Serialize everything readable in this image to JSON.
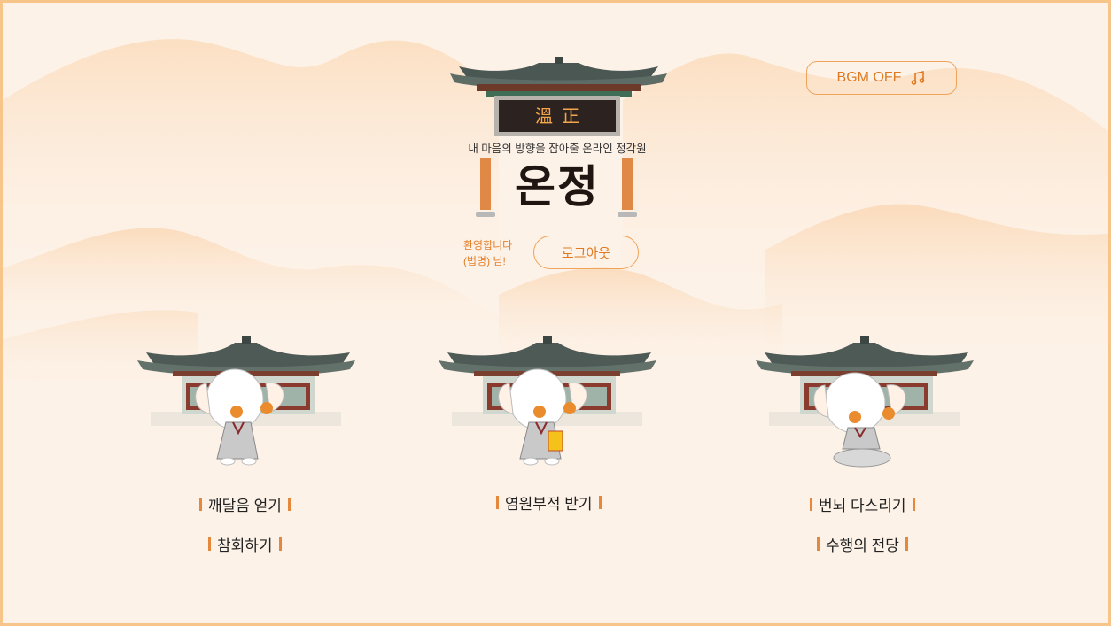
{
  "header": {
    "signboard_text": "溫正",
    "tagline": "내 마음의 방향을 잡아줄 온라인 정각원",
    "service_name": "온정",
    "bgm_button_label": "BGM OFF",
    "bgm_icon": "music-note-icon"
  },
  "user": {
    "welcome_line1": "환영합니다",
    "welcome_line2": "(법명) 님!",
    "logout_label": "로그아웃"
  },
  "menu": {
    "enlightenment": "깨달음 얻기",
    "repentance": "참회하기",
    "talisman": "염원부적 받기",
    "worries": "번뇌 다스리기",
    "hall": "수행의 전당"
  },
  "colors": {
    "accent": "#e5883c",
    "border": "#f7c48a",
    "background": "#fdf2e8"
  }
}
